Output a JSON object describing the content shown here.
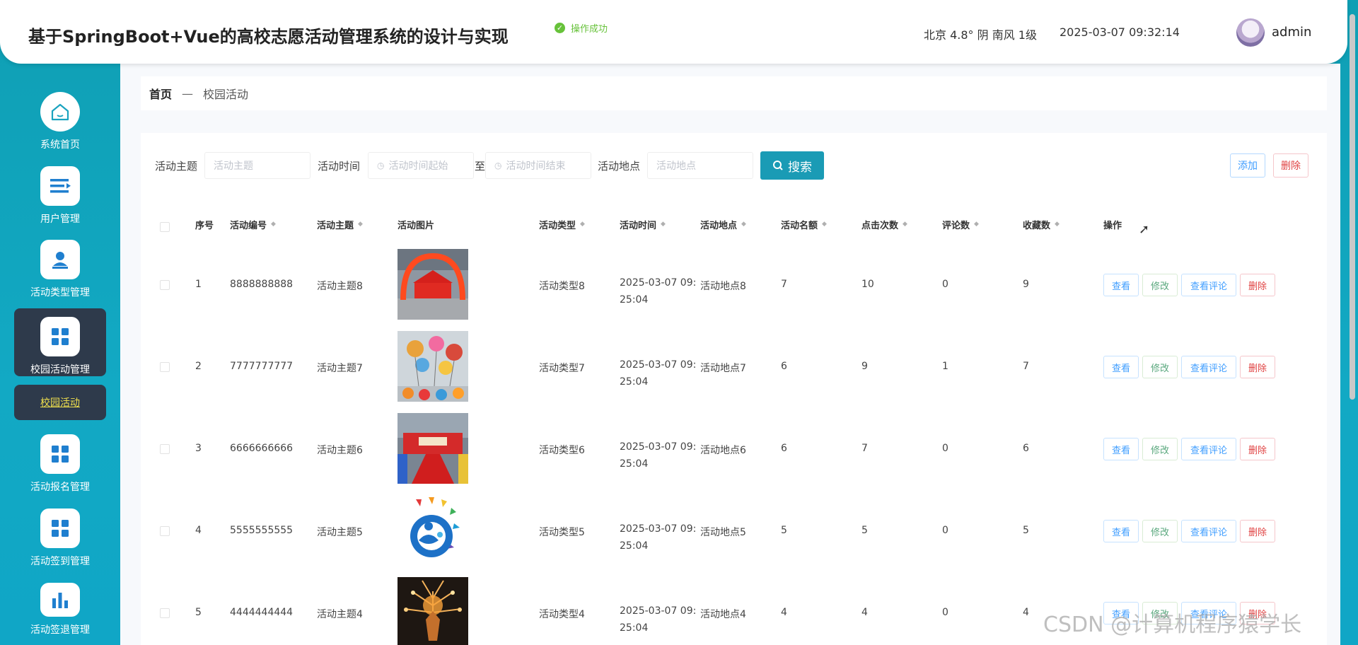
{
  "header": {
    "title": "基于SpringBoot+Vue的高校志愿活动管理系统的设计与实现",
    "toast": "操作成功",
    "weather": "北京  4.8°  阴  南风  1级",
    "datetime": "2025-03-07 09:32:14",
    "username": "admin"
  },
  "sidebar": {
    "items": [
      {
        "label": "系统首页",
        "icon": "home-icon"
      },
      {
        "label": "用户管理",
        "icon": "list-icon"
      },
      {
        "label": "活动类型管理",
        "icon": "user-icon"
      },
      {
        "label": "校园活动管理",
        "icon": "grid-icon"
      },
      {
        "label": "活动报名管理",
        "icon": "grid-icon"
      },
      {
        "label": "活动签到管理",
        "icon": "grid-icon"
      },
      {
        "label": "活动签退管理",
        "icon": "bar-chart-icon"
      }
    ],
    "submenu_label": "校园活动"
  },
  "breadcrumb": {
    "home": "首页",
    "separator": "—",
    "current": "校园活动"
  },
  "search": {
    "theme_label": "活动主题",
    "theme_placeholder": "活动主题",
    "time_label": "活动时间",
    "time_start_placeholder": "活动时间起始",
    "to_label": "至",
    "time_end_placeholder": "活动时间结束",
    "location_label": "活动地点",
    "location_placeholder": "活动地点",
    "search_button": "搜索",
    "add_button": "添加",
    "delete_button": "删除"
  },
  "table": {
    "headers": [
      "序号",
      "活动编号",
      "活动主题",
      "活动图片",
      "活动类型",
      "活动时间",
      "活动地点",
      "活动名额",
      "点击次数",
      "评论数",
      "收藏数",
      "操作"
    ],
    "rows": [
      {
        "index": "1",
        "code": "8888888888",
        "theme": "活动主题8",
        "type": "活动类型8",
        "time1": "2025-03-07 09:",
        "time2": "25:04",
        "location": "活动地点8",
        "quota": "7",
        "clicks": "10",
        "comments": "0",
        "favorites": "9",
        "image": "red-arch-tent"
      },
      {
        "index": "2",
        "code": "7777777777",
        "theme": "活动主题7",
        "type": "活动类型7",
        "time1": "2025-03-07 09:",
        "time2": "25:04",
        "location": "活动地点7",
        "quota": "6",
        "clicks": "9",
        "comments": "1",
        "favorites": "7",
        "image": "balloon-decoration"
      },
      {
        "index": "3",
        "code": "6666666666",
        "theme": "活动主题6",
        "type": "活动类型6",
        "time1": "2025-03-07 09:",
        "time2": "25:04",
        "location": "活动地点6",
        "quota": "6",
        "clicks": "7",
        "comments": "0",
        "favorites": "6",
        "image": "red-carpet-stage"
      },
      {
        "index": "4",
        "code": "5555555555",
        "theme": "活动主题5",
        "type": "活动类型5",
        "time1": "2025-03-07 09:",
        "time2": "25:04",
        "location": "活动地点5",
        "quota": "5",
        "clicks": "5",
        "comments": "0",
        "favorites": "5",
        "image": "volunteer-logo"
      },
      {
        "index": "5",
        "code": "4444444444",
        "theme": "活动主题4",
        "type": "活动类型4",
        "time1": "2025-03-07 09:",
        "time2": "25:04",
        "location": "活动地点4",
        "quota": "4",
        "clicks": "4",
        "comments": "0",
        "favorites": "4",
        "image": "fireworks-night"
      }
    ],
    "actions": {
      "view": "查看",
      "edit": "修改",
      "comments": "查看评论",
      "delete": "删除"
    }
  },
  "watermark": "CSDN @计算机程序猿学长",
  "colors": {
    "accent": "#1a9bb5",
    "sidebar_active": "#2e3a4b",
    "submenu_text": "#f0e04d",
    "toast": "#67c23a"
  }
}
